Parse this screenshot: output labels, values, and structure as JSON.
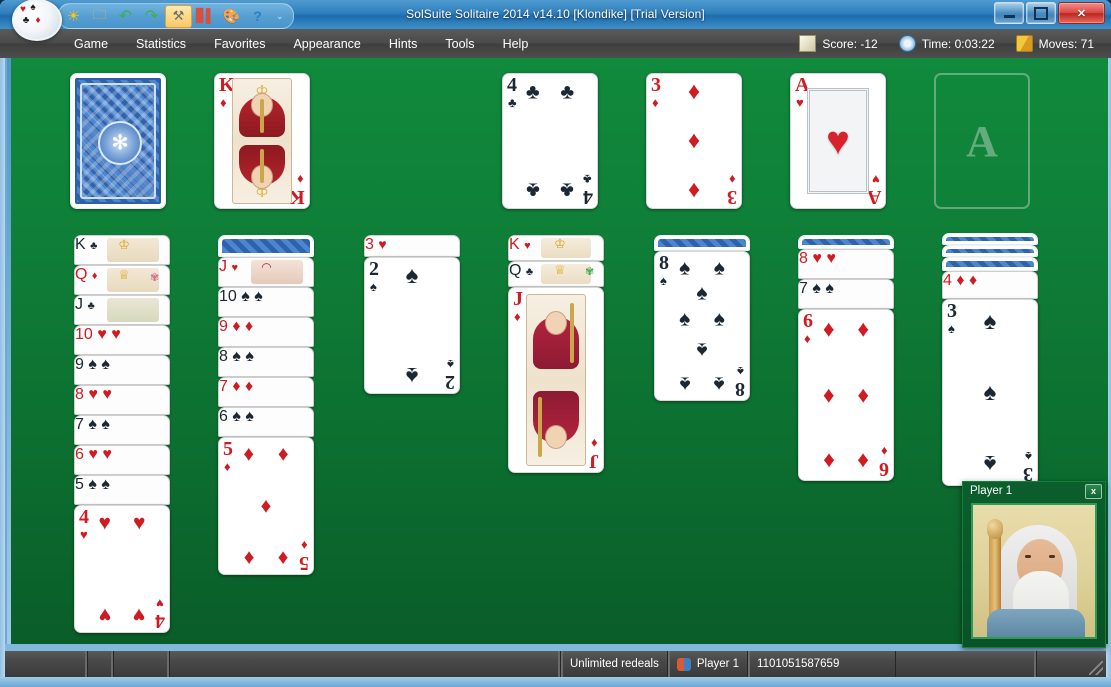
{
  "window": {
    "title": "SolSuite Solitaire 2014 v14.10  [Klondike]  [Trial Version]",
    "minimize_label": "",
    "maximize_label": "",
    "close_label": "✕"
  },
  "quick_toolbar": {
    "items": [
      {
        "name": "new-game-icon",
        "glyph": "☀"
      },
      {
        "name": "open-folder-icon",
        "glyph": "📁"
      },
      {
        "name": "undo-icon",
        "glyph": "↶"
      },
      {
        "name": "redo-icon",
        "glyph": "↷"
      },
      {
        "name": "tools-icon",
        "glyph": "🛠",
        "selected": true
      },
      {
        "name": "statistics-icon",
        "glyph": "📊"
      },
      {
        "name": "appearance-palette-icon",
        "glyph": "🎨"
      },
      {
        "name": "help-icon",
        "glyph": "❓"
      }
    ],
    "overflow_glyph": "⌄"
  },
  "menu": {
    "items": [
      {
        "label": "Game"
      },
      {
        "label": "Statistics"
      },
      {
        "label": "Favorites"
      },
      {
        "label": "Appearance"
      },
      {
        "label": "Hints"
      },
      {
        "label": "Tools"
      },
      {
        "label": "Help"
      }
    ]
  },
  "status_indicators": {
    "score_icon": "scroll-icon",
    "score_label": "Score:  -12",
    "time_icon": "clock-icon",
    "time_label": "Time:  0:03:22",
    "moves_icon": "cards-icon",
    "moves_label": "Moves:  71"
  },
  "statusbar": {
    "redeals": "Unlimited redeals",
    "player_icon": "players-icon",
    "player": "Player 1",
    "deal_number": "1101051587659"
  },
  "player_panel": {
    "title": "Player 1",
    "close_label": "x",
    "avatar_name": "wizard-avatar"
  },
  "game": {
    "name": "Klondike",
    "felt_color": "#0e7f38",
    "red_color": "#cf1b22",
    "black_color": "#1b2733",
    "stock": {
      "face_down": true,
      "label": "stock-pile"
    },
    "waste": {
      "rank": "K",
      "suit": "♦",
      "color": "red",
      "type": "court"
    },
    "foundations": [
      {
        "rank": "4",
        "suit": "♣",
        "color": "black",
        "empty": false
      },
      {
        "rank": "3",
        "suit": "♦",
        "color": "red",
        "empty": false
      },
      {
        "rank": "A",
        "suit": "♥",
        "color": "red",
        "empty": false
      },
      {
        "rank": "A",
        "suit": "",
        "color": "black",
        "empty": true,
        "placeholder": "A"
      }
    ],
    "tableau": [
      {
        "column": 1,
        "face_down": 0,
        "cards": [
          {
            "rank": "K",
            "suit": "♣",
            "color": "black",
            "type": "court"
          },
          {
            "rank": "Q",
            "suit": "♦",
            "color": "red",
            "type": "court"
          },
          {
            "rank": "J",
            "suit": "♣",
            "color": "black",
            "type": "court"
          },
          {
            "rank": "10",
            "suit": "♥",
            "color": "red"
          },
          {
            "rank": "9",
            "suit": "♠",
            "color": "black"
          },
          {
            "rank": "8",
            "suit": "♥",
            "color": "red"
          },
          {
            "rank": "7",
            "suit": "♠",
            "color": "black"
          },
          {
            "rank": "6",
            "suit": "♥",
            "color": "red"
          },
          {
            "rank": "5",
            "suit": "♠",
            "color": "black"
          },
          {
            "rank": "4",
            "suit": "♥",
            "color": "red",
            "top": true
          }
        ]
      },
      {
        "column": 2,
        "face_down": 1,
        "cards": [
          {
            "rank": "J",
            "suit": "♥",
            "color": "red",
            "type": "court"
          },
          {
            "rank": "10",
            "suit": "♠",
            "color": "black"
          },
          {
            "rank": "9",
            "suit": "♦",
            "color": "red"
          },
          {
            "rank": "8",
            "suit": "♠",
            "color": "black"
          },
          {
            "rank": "7",
            "suit": "♦",
            "color": "red"
          },
          {
            "rank": "6",
            "suit": "♠",
            "color": "black"
          },
          {
            "rank": "5",
            "suit": "♦",
            "color": "red",
            "top": true
          }
        ]
      },
      {
        "column": 3,
        "face_down": 0,
        "cards": [
          {
            "rank": "3",
            "suit": "♥",
            "color": "red"
          },
          {
            "rank": "2",
            "suit": "♠",
            "color": "black",
            "top": true
          }
        ]
      },
      {
        "column": 4,
        "face_down": 0,
        "cards": [
          {
            "rank": "K",
            "suit": "♥",
            "color": "red",
            "type": "court"
          },
          {
            "rank": "Q",
            "suit": "♣",
            "color": "black",
            "type": "court"
          },
          {
            "rank": "J",
            "suit": "♦",
            "color": "red",
            "type": "court",
            "top": true
          }
        ]
      },
      {
        "column": 5,
        "face_down": 1,
        "cards": [
          {
            "rank": "8",
            "suit": "♠",
            "color": "black",
            "top": true
          }
        ]
      },
      {
        "column": 6,
        "face_down": 1,
        "cards": [
          {
            "rank": "8",
            "suit": "♥",
            "color": "red"
          },
          {
            "rank": "7",
            "suit": "♠",
            "color": "black"
          },
          {
            "rank": "6",
            "suit": "♦",
            "color": "red",
            "top": true
          }
        ]
      },
      {
        "column": 7,
        "face_down": 3,
        "cards": [
          {
            "rank": "4",
            "suit": "♦",
            "color": "red"
          },
          {
            "rank": "3",
            "suit": "♠",
            "color": "black",
            "top": true
          }
        ]
      }
    ]
  }
}
